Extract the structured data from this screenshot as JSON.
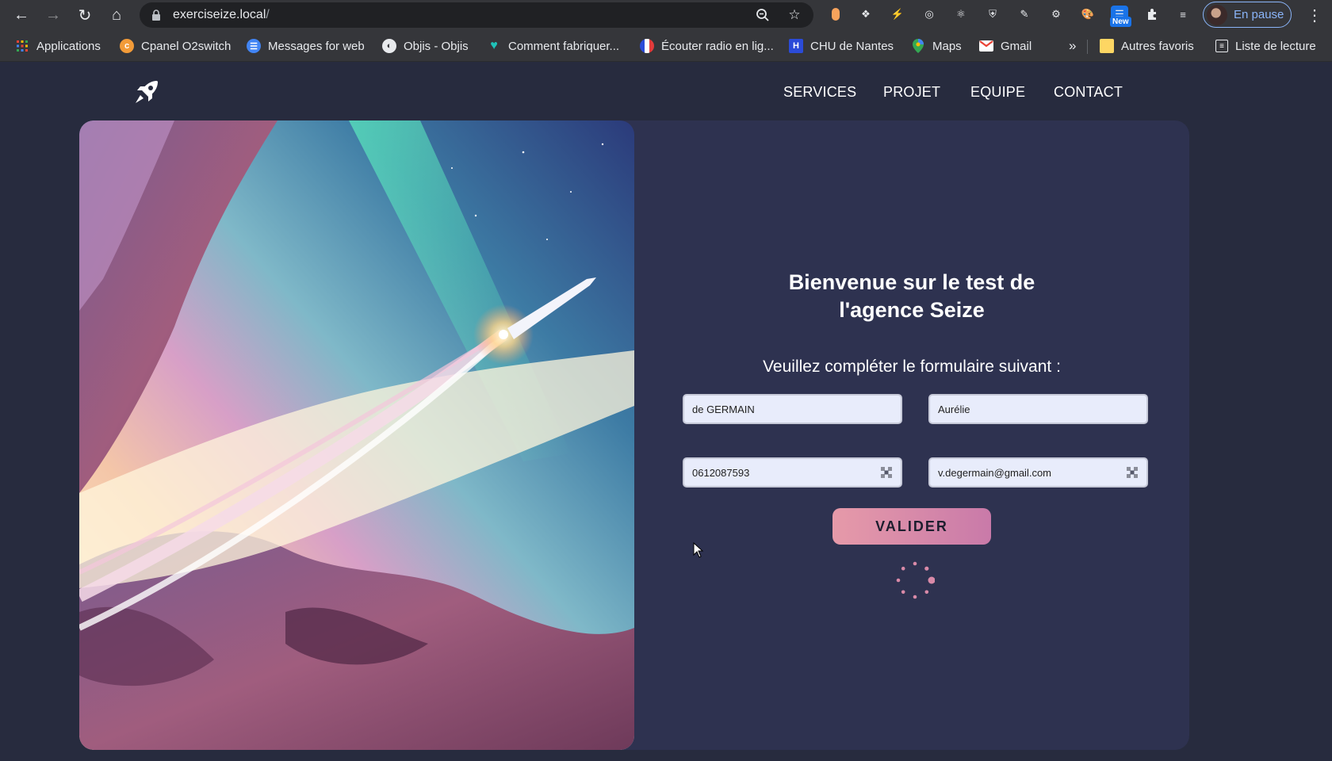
{
  "browser": {
    "url_host": "exerciseize.local",
    "url_path": "/",
    "profile_label": "En pause",
    "new_badge": "New",
    "bookmarks": [
      {
        "label": "Applications",
        "icon": "apps-grid-icon",
        "color": "#ea4335"
      },
      {
        "label": "Cpanel O2switch",
        "icon": "cpanel-icon",
        "color": "#f29b38"
      },
      {
        "label": "Messages for web",
        "icon": "messages-icon",
        "color": "#4285f4"
      },
      {
        "label": "Objis - Objis",
        "icon": "globe-icon",
        "color": "#e8eaed"
      },
      {
        "label": "Comment fabriquer...",
        "icon": "heart-icon",
        "color": "#1fc2b8"
      },
      {
        "label": "Écouter radio en lig...",
        "icon": "radio-france-icon",
        "color": "#e23b3b"
      },
      {
        "label": "CHU de Nantes",
        "icon": "hospital-icon",
        "color": "#2b4bd8"
      },
      {
        "label": "Maps",
        "icon": "maps-pin-icon",
        "color": "#34a853"
      },
      {
        "label": "Gmail",
        "icon": "gmail-icon",
        "color": "#ea4335"
      }
    ],
    "overflow": "»",
    "other_favorites": "Autres favoris",
    "reading_list": "Liste de lecture"
  },
  "site": {
    "nav": [
      "SERVICES",
      "PROJET",
      "EQUIPE",
      "CONTACT"
    ],
    "title_line1": "Bienvenue sur le test de",
    "title_line2": "l'agence Seize",
    "subtitle": "Veuillez compléter le formulaire suivant :",
    "form": {
      "last_name": "de GERMAIN",
      "first_name": "Aurélie",
      "phone": "0612087593",
      "email": "v.degermain@gmail.com"
    },
    "submit_label": "VALIDER",
    "accent": "#e69aa9",
    "loading": true
  }
}
